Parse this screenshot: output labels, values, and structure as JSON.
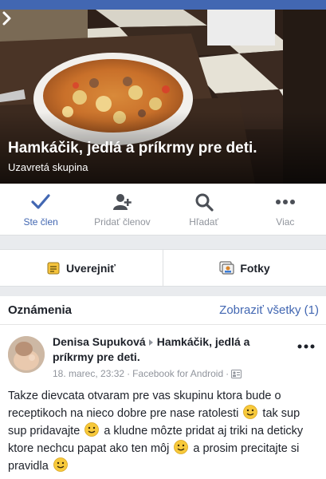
{
  "group": {
    "name": "Hamkáčik, jedlá a príkrmy pre deti.",
    "privacy": "Uzavretá skupina"
  },
  "actions": [
    {
      "label": "Ste člen",
      "icon": "checkmark-icon",
      "active": true
    },
    {
      "label": "Pridať členov",
      "icon": "add-person-icon",
      "active": false
    },
    {
      "label": "Hľadať",
      "icon": "search-icon",
      "active": false
    },
    {
      "label": "Viac",
      "icon": "more-dots-icon",
      "active": false
    }
  ],
  "composer": {
    "post_label": "Uverejniť",
    "photos_label": "Fotky"
  },
  "notices": {
    "title": "Oznámenia",
    "see_all": "Zobraziť všetky (1)"
  },
  "post": {
    "author": "Denisa Supuková",
    "group": "Hamkáčik, jedlá a príkrmy pre deti.",
    "time": "18. marec, 23:32",
    "separator": "·",
    "source": "Facebook for Android",
    "body_segments": [
      "Takze dievcata otvaram pre vas skupinu ktora bude o receptikoch na nieco dobre pre nase ratolesti",
      "tak sup sup pridavajte",
      "a kludne môzte pridat aj triki na deticky ktore nechcu papat ako ten môj",
      "a prosim precitajte si pravidla"
    ]
  },
  "colors": {
    "brand": "#4267b2",
    "muted": "#90949c",
    "text": "#1d2129",
    "background": "#e9ebee"
  }
}
